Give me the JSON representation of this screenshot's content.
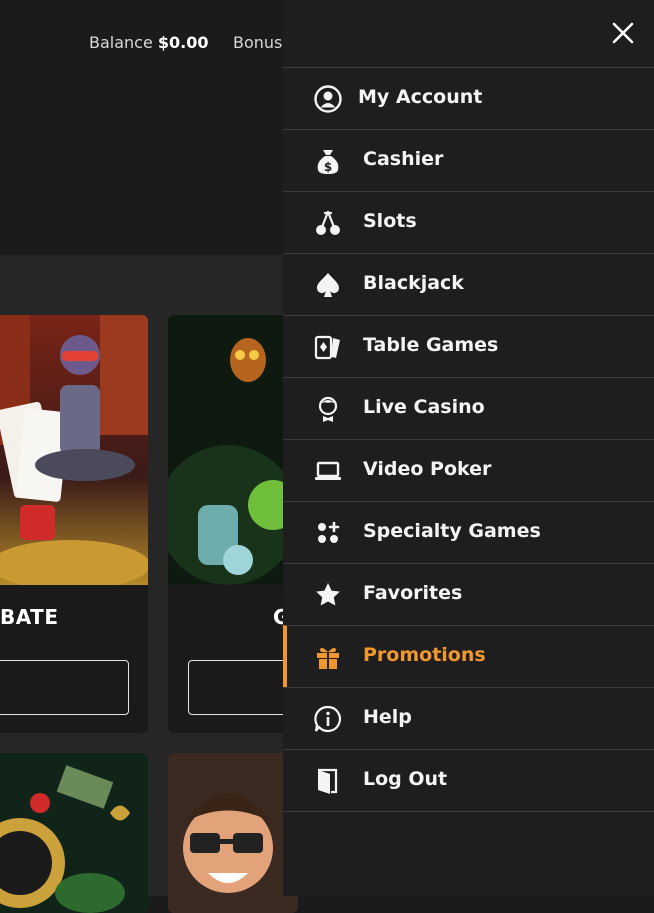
{
  "header": {
    "balance_label": "Balance",
    "balance_value": "$0.00",
    "bonus_label": "Bonus"
  },
  "cards": [
    {
      "title": "BATE"
    },
    {
      "title": "G"
    }
  ],
  "menu": {
    "close_icon": "close-icon",
    "accent_color": "#f0982d",
    "items": [
      {
        "label": "My Account",
        "icon": "user-circle-icon"
      },
      {
        "label": "Cashier",
        "icon": "money-bag-icon"
      },
      {
        "label": "Slots",
        "icon": "cherries-icon"
      },
      {
        "label": "Blackjack",
        "icon": "spade-icon"
      },
      {
        "label": "Table Games",
        "icon": "cards-icon"
      },
      {
        "label": "Live Casino",
        "icon": "dealer-icon"
      },
      {
        "label": "Video Poker",
        "icon": "laptop-icon"
      },
      {
        "label": "Specialty Games",
        "icon": "dice-dots-icon"
      },
      {
        "label": "Favorites",
        "icon": "star-icon"
      },
      {
        "label": "Promotions",
        "icon": "gift-icon",
        "active": true
      },
      {
        "label": "Help",
        "icon": "info-icon"
      },
      {
        "label": "Log Out",
        "icon": "door-icon"
      }
    ]
  }
}
